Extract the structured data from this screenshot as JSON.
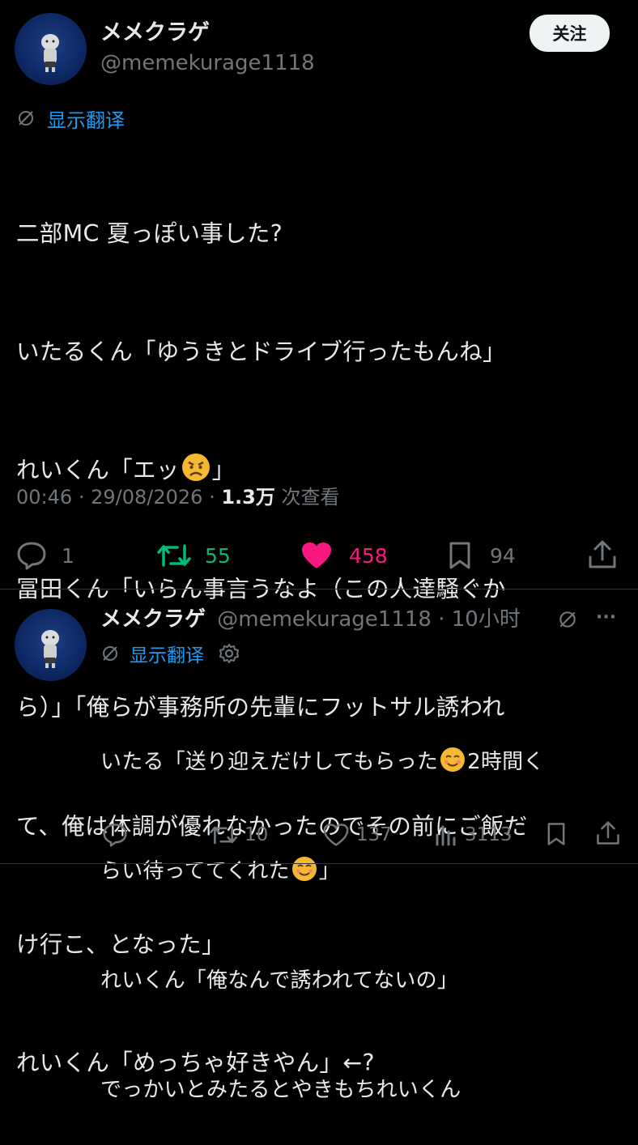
{
  "main_tweet": {
    "display_name": "メメクラゲ",
    "handle": "@memekurage1118",
    "follow_label": "关注",
    "translate_label": "显示翻译",
    "lines": [
      "二部MC 夏っぽい事した?",
      "いたるくん「ゆうきとドライブ行ったもんね」",
      "れいくん「エッ",
      "」",
      "冨田くん「いらん事言うなよ（この人達騒ぐか",
      "ら）」「俺らが事務所の先輩にフットサル誘われ",
      "て、俺は体調が優れなかったのでその前にご飯だ",
      "け行こ、となった」",
      "れいくん「めっちゃ好きやん」←?"
    ],
    "time": "00:46",
    "sep1": "·",
    "date": "29/08/2026",
    "sep2": "·",
    "views_count": "1.3万",
    "views_label": "次查看",
    "replies": "1",
    "retweets": "55",
    "likes": "458",
    "bookmarks": "94",
    "colors": {
      "retweet": "#00ba7c",
      "like": "#f91880",
      "link": "#1d9bf0"
    }
  },
  "reply_tweet": {
    "display_name": "メメクラゲ",
    "handle": "@memekurage1118",
    "sep": "·",
    "time_ago": "10小时",
    "more": "···",
    "translate_label": "显示翻译",
    "line1a": "いたる「送り迎えだけしてもらった",
    "line1b": "2時間く",
    "line2a": "らい待っててくれた",
    "line2b": "」",
    "line3": "れいくん「俺なんで誘われてないの」",
    "line4": "でっかいとみたるとやきもちれいくん",
    "replies": "",
    "retweets": "10",
    "likes": "137",
    "views": "3113"
  }
}
